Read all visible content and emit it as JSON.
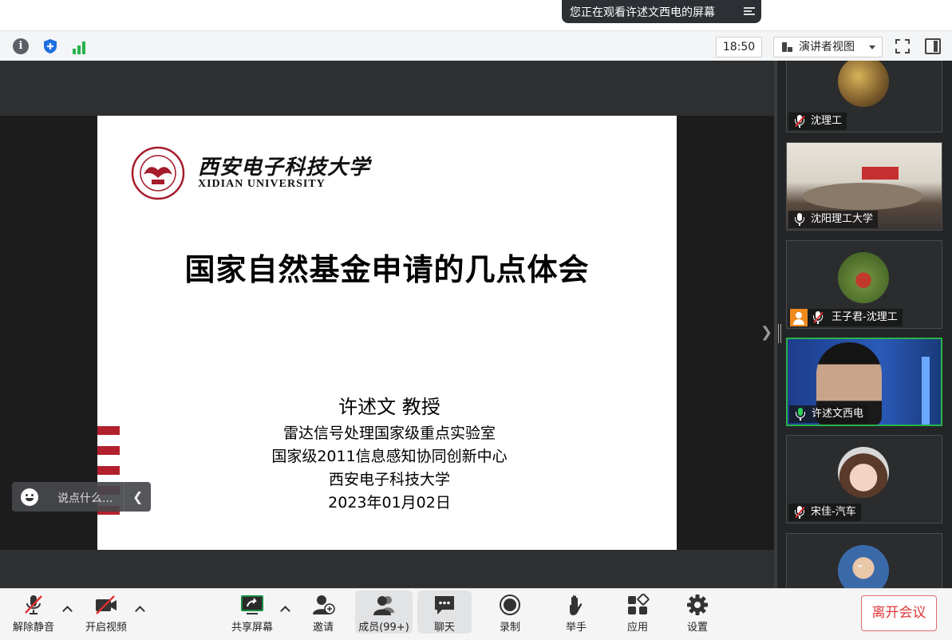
{
  "banner": {
    "text": "您正在观看许述文西电的屏幕"
  },
  "toolbar": {
    "icons": [
      "info-icon",
      "shield-icon",
      "signal-icon"
    ],
    "time": "18:50",
    "view_mode": "演讲者视图",
    "right_icons": [
      "fullscreen-icon",
      "side-panel-icon"
    ]
  },
  "slide": {
    "logo_cn": "西安电子科技大学",
    "logo_en": "XIDIAN UNIVERSITY",
    "title": "国家自然基金申请的几点体会",
    "presenter": "许述文  教授",
    "affiliations": [
      "雷达信号处理国家级重点实验室",
      "国家级2011信息感知协同创新中心",
      "西安电子科技大学",
      "2023年01月02日"
    ]
  },
  "chat": {
    "placeholder": "说点什么..."
  },
  "participants": [
    {
      "name": "沈理工",
      "muted": true
    },
    {
      "name": "沈阳理工大学",
      "muted": false
    },
    {
      "name": "王子君-沈理工",
      "muted": true,
      "placeholder_avatar": true
    },
    {
      "name": "许述文西电",
      "muted": false,
      "active": true
    },
    {
      "name": "宋佳-汽车",
      "muted": true
    },
    {
      "name": "",
      "muted": false
    }
  ],
  "controls": {
    "mute": "解除静音",
    "video": "开启视频",
    "share": "共享屏幕",
    "invite": "邀请",
    "members": "成员(99+)",
    "chat": "聊天",
    "record": "录制",
    "raise_hand": "举手",
    "apps": "应用",
    "settings": "设置",
    "leave": "离开会议"
  },
  "colors": {
    "accent_green": "#27b34c",
    "leave_red": "#e0383a",
    "slide_stripe": "#b2202d"
  }
}
